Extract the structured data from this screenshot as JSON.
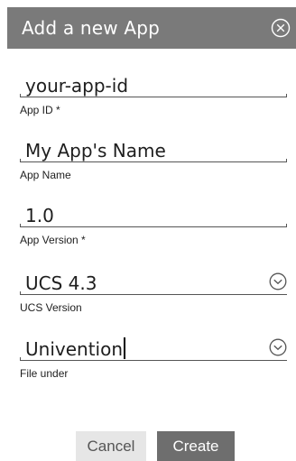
{
  "dialog": {
    "title": "Add a new App",
    "close_icon": "close-circle-icon"
  },
  "fields": {
    "app_id": {
      "value": "your-app-id",
      "label": "App ID *"
    },
    "app_name": {
      "value": "My App's Name",
      "label": "App Name"
    },
    "app_version": {
      "value": "1.0",
      "label": "App Version *"
    },
    "ucs_version": {
      "value": "UCS 4.3",
      "label": "UCS Version",
      "icon": "chevron-down-circle-icon"
    },
    "file_under": {
      "value": "Univention",
      "label": "File under",
      "icon": "chevron-down-circle-icon"
    }
  },
  "buttons": {
    "cancel": "Cancel",
    "create": "Create"
  },
  "colors": {
    "titlebar": "#7a7a7a",
    "create_button": "#6e6e6e",
    "cancel_button": "#e6e6e6"
  }
}
